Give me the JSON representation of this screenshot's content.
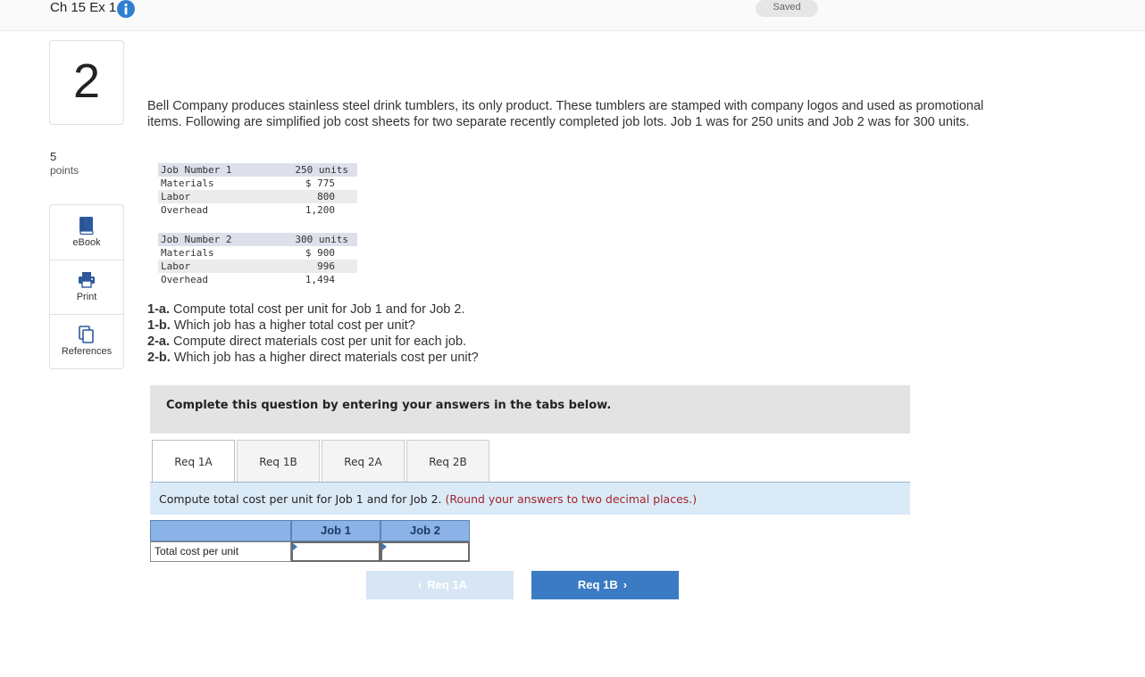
{
  "header": {
    "exercise_title": "Ch 15 Ex 1",
    "saved_label": "Saved"
  },
  "question": {
    "number": "2",
    "points_value": "5",
    "points_label": "points"
  },
  "side_tools": [
    {
      "label": "eBook",
      "icon": "book-icon"
    },
    {
      "label": "Print",
      "icon": "printer-icon"
    },
    {
      "label": "References",
      "icon": "references-icon"
    }
  ],
  "intro_text": "Bell Company produces stainless steel drink tumblers, its only product. These tumblers are stamped with company logos and used as promotional items. Following are simplified job cost sheets for two separate recently completed job lots. Job 1 was for 250 units and Job 2 was for 300 units.",
  "job1": {
    "rows": [
      {
        "label": "Job Number 1",
        "value": "250 units"
      },
      {
        "label": "Materials",
        "value": "$ 775"
      },
      {
        "label": "Labor",
        "value": "800"
      },
      {
        "label": "Overhead",
        "value": "1,200"
      }
    ]
  },
  "job2": {
    "rows": [
      {
        "label": "Job Number 2",
        "value": "300 units"
      },
      {
        "label": "Materials",
        "value": "$ 900"
      },
      {
        "label": "Labor",
        "value": "996"
      },
      {
        "label": "Overhead",
        "value": "1,494"
      }
    ]
  },
  "questions": [
    {
      "key": "1-a.",
      "text": "Compute total cost per unit for Job 1 and for Job 2."
    },
    {
      "key": "1-b.",
      "text": "Which job has a higher total cost per unit?"
    },
    {
      "key": "2-a.",
      "text": "Compute direct materials cost per unit for each job."
    },
    {
      "key": "2-b.",
      "text": "Which job has a higher direct materials cost per unit?"
    }
  ],
  "instruction": "Complete this question by entering your answers in the tabs below.",
  "tabs": [
    {
      "label": "Req 1A",
      "active": true
    },
    {
      "label": "Req 1B",
      "active": false
    },
    {
      "label": "Req 2A",
      "active": false
    },
    {
      "label": "Req 2B",
      "active": false
    }
  ],
  "prompt": {
    "text": "Compute total cost per unit for Job 1 and for Job 2.",
    "note": "(Round your answers to two decimal places.)"
  },
  "answer_table": {
    "columns": [
      "Job 1",
      "Job 2"
    ],
    "row_label": "Total cost per unit",
    "values": [
      "",
      ""
    ]
  },
  "navigation": {
    "prev_label": "Req 1A",
    "next_label": "Req 1B"
  },
  "colors": {
    "accent": "#3b7bc4",
    "note_red": "#a3242b",
    "table_header": "#8cb3e8"
  }
}
